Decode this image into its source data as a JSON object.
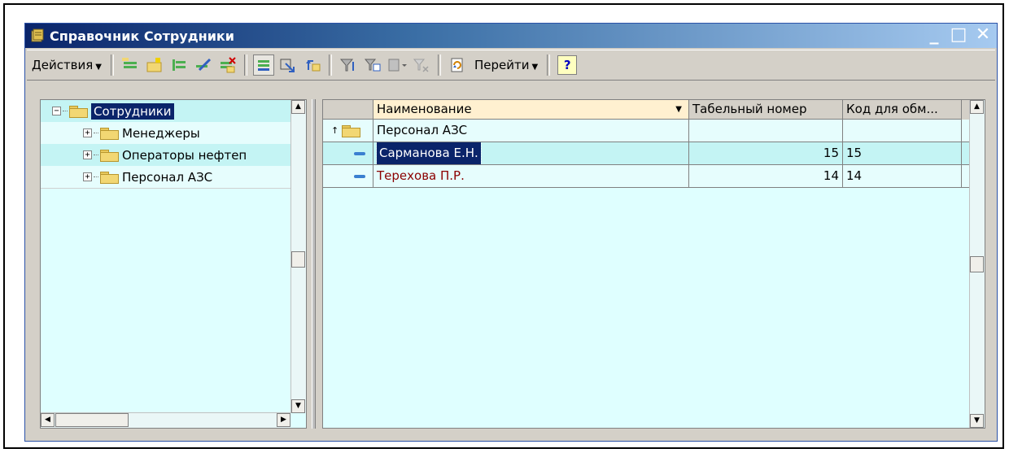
{
  "window": {
    "title": "Справочник Сотрудники",
    "controls": {
      "minimize": "_",
      "maximize": "□",
      "close": "✕"
    }
  },
  "toolbar": {
    "actions_label": "Действия",
    "goto_label": "Перейти",
    "help_label": "?"
  },
  "tree": {
    "root": {
      "label": "Сотрудники",
      "expander": "−"
    },
    "items": [
      {
        "label": "Менеджеры",
        "expander": "+"
      },
      {
        "label": "Операторы нефтеп",
        "expander": "+"
      },
      {
        "label": "Персонал АЗС",
        "expander": "+"
      }
    ]
  },
  "grid": {
    "columns": [
      "",
      "Наименование",
      "Табельный номер",
      "Код для обм..."
    ],
    "parent_row": {
      "name": "Персонал АЗС"
    },
    "rows": [
      {
        "name": "Сарманова Е.Н.",
        "tab_number": "15",
        "code": "15",
        "selected": true
      },
      {
        "name": "Терехова П.Р.",
        "tab_number": "14",
        "code": "14",
        "selected": false
      }
    ]
  },
  "colors": {
    "title_bar": "#0a246a",
    "panel_bg": "#dfffff",
    "selection": "#0a246a",
    "item_text_red": "#8b0000"
  }
}
